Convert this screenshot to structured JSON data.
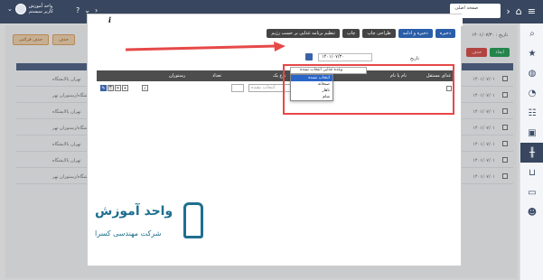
{
  "topbar": {
    "user_name": "واحد آموزش",
    "user_role": "کاربر سیستم",
    "tab_label": "صفحه اصلی",
    "help_glyph": "?",
    "back_glyph": "›",
    "home_glyph": "⌂"
  },
  "background": {
    "date_text": "تاریخ : ۱۴۰۱/۰۷/۳۰",
    "delete_button": "حذف",
    "print_button": "حذف قرائتی",
    "new_button": "ایجاد",
    "remove_button": "حذف",
    "rows": [
      {
        "left": "تهران پالایشگاه",
        "right": "۱۴۰۱/۰۷/۰۱"
      },
      {
        "left": "پالایشگاه/رستوران تهر...",
        "right": "۱۴۰۱/۰۷/۰۱"
      },
      {
        "left": "تهران پالایشگاه",
        "right": "۱۴۰۱/۰۷/۰۱"
      },
      {
        "left": "پالایشگاه/رستوران تهر...",
        "right": "۱۴۰۱/۰۷/۰۱"
      },
      {
        "left": "تهران پالایشگاه",
        "right": "۱۴۰۱/۰۷/۰۱"
      },
      {
        "left": "تهران پالایشگاه",
        "right": "۱۴۰۱/۰۷/۰۱"
      },
      {
        "left": "پالایشگاه/رستوران تهر...",
        "right": "۱۴۰۱/۰۷/۰۱"
      }
    ]
  },
  "modal": {
    "info_glyph": "i",
    "toolbar": {
      "save": "ذخیره",
      "save_and_continue": "ذخیره و ادامه",
      "print_layout": "طراحی چاپ",
      "print": "چاپ",
      "arrange_by_diet": "تنظیم برنامه غذایی بر حسب رژیم"
    },
    "date_label": "تاریخ",
    "date_value": "۱۴۰۱/۰۷/۳۰",
    "grid": {
      "col_food": "غذای مستقل",
      "col_name": "نام یا نام",
      "col_meal": "نوع وعده",
      "col_type": "نوع یک",
      "col_qty": "تعداد",
      "col_restaurant": "رستوران",
      "meal_placeholder": "انتخاب نشده"
    },
    "dropdown": {
      "current": "وعده غذایی انتخاب نشده",
      "items": [
        {
          "label": "انتخاب نشده",
          "selected": true
        },
        {
          "label": "صبحانه",
          "selected": false
        },
        {
          "label": "ناهار",
          "selected": false
        },
        {
          "label": "شام",
          "selected": false
        }
      ]
    }
  },
  "watermark": {
    "title": "واحد آموزش",
    "subtitle": "شرکت مهندسی کسرا"
  },
  "colors": {
    "topbar": "#38465f",
    "accent_blue": "#2a5ea8",
    "highlight_red": "#e74848",
    "logo": "#1f6f8f"
  }
}
